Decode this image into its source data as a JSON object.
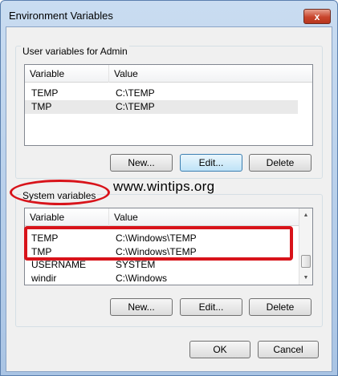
{
  "window": {
    "title": "Environment Variables",
    "close_glyph": "x"
  },
  "user_vars": {
    "group_label": "User variables for Admin",
    "headers": [
      "Variable",
      "Value"
    ],
    "rows": [
      {
        "variable": "TEMP",
        "value": "C:\\TEMP"
      },
      {
        "variable": "TMP",
        "value": "C:\\TEMP"
      }
    ],
    "buttons": {
      "new": "New...",
      "edit": "Edit...",
      "delete": "Delete"
    }
  },
  "system_vars": {
    "group_label": "System variables",
    "headers": [
      "Variable",
      "Value"
    ],
    "rows": [
      {
        "variable": "TEMP",
        "value": "C:\\Windows\\TEMP"
      },
      {
        "variable": "TMP",
        "value": "C:\\Windows\\TEMP"
      },
      {
        "variable": "USERNAME",
        "value": "SYSTEM"
      },
      {
        "variable": "windir",
        "value": "C:\\Windows"
      }
    ],
    "buttons": {
      "new": "New...",
      "edit": "Edit...",
      "delete": "Delete"
    }
  },
  "dialog_buttons": {
    "ok": "OK",
    "cancel": "Cancel"
  },
  "watermark": "www.wintips.org",
  "colors": {
    "highlight": "#d8131a"
  }
}
